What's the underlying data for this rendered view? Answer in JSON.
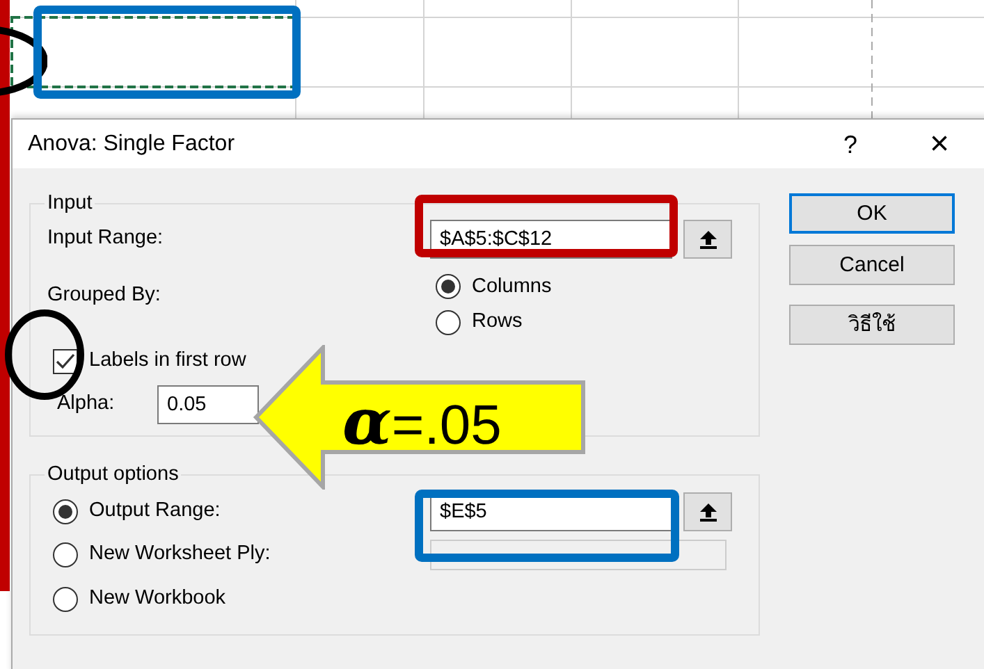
{
  "dialog": {
    "title": "Anova: Single Factor",
    "help_glyph": "?",
    "close_glyph": "×"
  },
  "input": {
    "legend": "Input",
    "range_label": "Input Range:",
    "range_value": "$A$5:$C$12",
    "grouped_label": "Grouped By:",
    "grouping": [
      {
        "label": "Columns",
        "selected": true
      },
      {
        "label": "Rows",
        "selected": false
      }
    ],
    "labels_checkbox": {
      "label": "Labels in first row",
      "checked": true
    },
    "alpha_label": "Alpha:",
    "alpha_value": "0.05"
  },
  "output": {
    "legend": "Output options",
    "options": [
      {
        "label": "Output Range:",
        "selected": true,
        "value": "$E$5",
        "disabled": false
      },
      {
        "label": "New Worksheet Ply:",
        "selected": false,
        "disabled": true
      },
      {
        "label": "New Workbook",
        "selected": false
      }
    ]
  },
  "buttons": [
    {
      "label": "OK",
      "default": true
    },
    {
      "label": "Cancel",
      "default": false
    },
    {
      "label": "วิธีใช้",
      "default": false
    }
  ],
  "annotations": [
    {
      "kind": "bar",
      "color": "#c00000"
    },
    {
      "kind": "ellipse",
      "color": "#000000"
    },
    {
      "kind": "frame",
      "color": "#0070c0"
    },
    {
      "kind": "frame",
      "color": "#c00000"
    },
    {
      "kind": "ellipse",
      "color": "#000000"
    },
    {
      "kind": "arrow",
      "color": "#ffff00",
      "text": "**α**=.05"
    },
    {
      "kind": "frame",
      "color": "#0070c0"
    }
  ]
}
